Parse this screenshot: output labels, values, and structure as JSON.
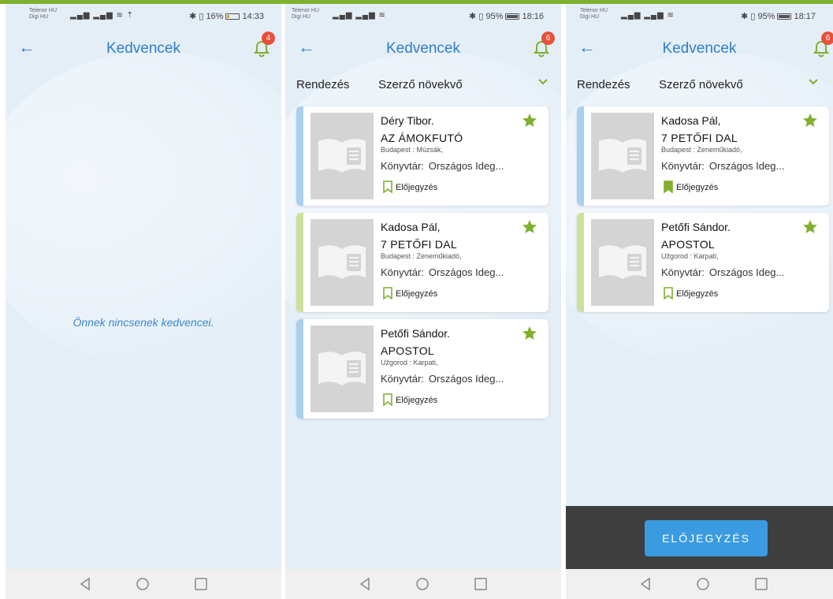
{
  "screens": [
    {
      "status": {
        "carrier1": "Telenor HU",
        "carrier2": "Digi HU",
        "right": "16%",
        "time": "14:33"
      },
      "header": {
        "title": "Kedvencek",
        "badge": "4"
      },
      "empty_text": "Önnek nincsenek kedvencei."
    },
    {
      "status": {
        "carrier1": "Telenor HU",
        "carrier2": "Digi HU",
        "right": "95%",
        "time": "18:16"
      },
      "header": {
        "title": "Kedvencek",
        "badge": "6"
      },
      "sort": {
        "label": "Rendezés",
        "value": "Szerző növekvő"
      },
      "cards": [
        {
          "author": "Déry Tibor.",
          "title": "AZ ÁMOKFUTÓ",
          "publisher": "Budapest : Múzsák,",
          "library_label": "Könyvtár:",
          "library_value": "Országos Ideg...",
          "reserve": "Előjegyzés",
          "stripe": "#a9d0ee",
          "reserved": false
        },
        {
          "author": "Kadosa Pál,",
          "title": "7 PETŐFI DAL",
          "publisher": "Budapest : Zeneműkiadó,",
          "library_label": "Könyvtár:",
          "library_value": "Országos Ideg...",
          "reserve": "Előjegyzés",
          "stripe": "#cfe09e",
          "reserved": false
        },
        {
          "author": "Petőfi Sándor.",
          "title": "APOSTOL",
          "publisher": "Užgorod : Karpati,",
          "library_label": "Könyvtár:",
          "library_value": "Országos Ideg...",
          "reserve": "Előjegyzés",
          "stripe": "#a9d0ee",
          "reserved": false
        }
      ]
    },
    {
      "status": {
        "carrier1": "Telenor HU",
        "carrier2": "Digi HU",
        "right": "95%",
        "time": "18:17"
      },
      "header": {
        "title": "Kedvencek",
        "badge": "6"
      },
      "sort": {
        "label": "Rendezés",
        "value": "Szerző növekvő"
      },
      "cards": [
        {
          "author": "Kadosa Pál,",
          "title": "7 PETŐFI DAL",
          "publisher": "Budapest : Zeneműkiadó,",
          "library_label": "Könyvtár:",
          "library_value": "Országos Ideg...",
          "reserve": "Előjegyzés",
          "stripe": "#a9d0ee",
          "reserved": true
        },
        {
          "author": "Petőfi Sándor.",
          "title": "APOSTOL",
          "publisher": "Užgorod : Karpati,",
          "library_label": "Könyvtár:",
          "library_value": "Országos Ideg...",
          "reserve": "Előjegyzés",
          "stripe": "#cfe09e",
          "reserved": false
        }
      ],
      "action_button": "ELŐJEGYZÉS"
    }
  ],
  "colors": {
    "accent_blue": "#2f7fc9",
    "accent_green": "#7fb02e",
    "badge_red": "#e8503a",
    "button_blue": "#3a9be0"
  }
}
